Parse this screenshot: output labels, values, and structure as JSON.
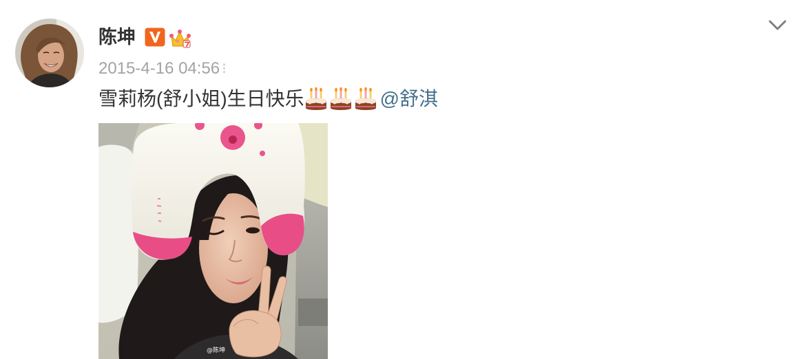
{
  "post": {
    "author": {
      "name": "陈坤",
      "badges": [
        "verified-v-icon",
        "vip-crown-icon"
      ]
    },
    "timestamp": "2015-4-16 04:56",
    "timestamp_trail": "⁝",
    "content": {
      "text": "雪莉杨(舒小姐)生日快乐",
      "emoji": [
        "cake-icon",
        "cake-icon",
        "cake-icon"
      ],
      "mention": "@舒淇"
    },
    "image": {
      "watermark": "@陈坤"
    }
  },
  "menu": {
    "icon": "chevron-down-icon"
  },
  "colors": {
    "background": "#ffffff",
    "name": "#333333",
    "timestamp": "#a3a3a3",
    "text": "#333333",
    "mention": "#44708c",
    "verified_badge": "#f0661e",
    "vip_badge": "#f6c12b"
  }
}
